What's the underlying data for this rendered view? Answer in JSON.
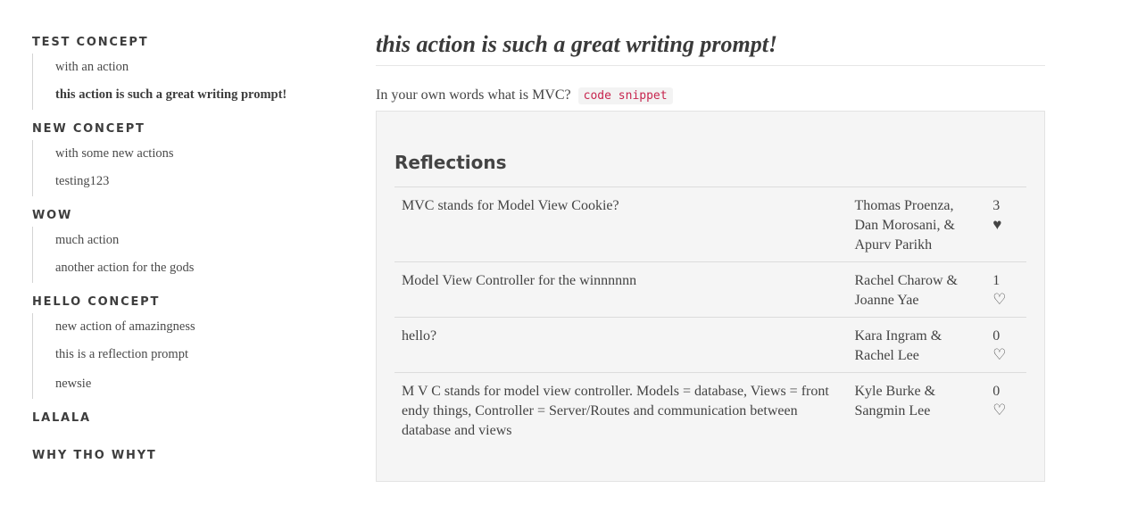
{
  "sidebar": {
    "sections": [
      {
        "title": "TEST CONCEPT",
        "items": [
          {
            "label": "with an action",
            "active": false
          },
          {
            "label": "this action is such a great writing prompt!",
            "active": true
          }
        ]
      },
      {
        "title": "NEW CONCEPT",
        "items": [
          {
            "label": "with some new actions",
            "active": false
          },
          {
            "label": "testing123",
            "active": false
          }
        ]
      },
      {
        "title": "WOW",
        "items": [
          {
            "label": "much action",
            "active": false
          },
          {
            "label": "another action for the gods",
            "active": false
          }
        ]
      },
      {
        "title": "HELLO CONCEPT",
        "items": [
          {
            "label": "new action of amazingness",
            "active": false
          },
          {
            "label": "this is a reflection prompt",
            "active": false
          },
          {
            "label": "newsie",
            "active": false
          }
        ]
      },
      {
        "title": "LALALA",
        "items": []
      },
      {
        "title": "WHY THO WHYT",
        "items": []
      }
    ]
  },
  "main": {
    "prompt_title": "this action is such a great writing prompt!",
    "question": "In your own words what is MVC?",
    "code_snippet": "code snippet",
    "reflections_heading": "Reflections",
    "reflections": [
      {
        "answer": "MVC stands for Model View Cookie?",
        "authors": "Thomas Proenza, Dan Morosani, & Apurv Parikh",
        "likes": "3",
        "liked": true
      },
      {
        "answer": "Model View Controller for the winnnnnn",
        "authors": "Rachel Charow & Joanne Yae",
        "likes": "1",
        "liked": false
      },
      {
        "answer": "hello?",
        "authors": "Kara Ingram & Rachel Lee",
        "likes": "0",
        "liked": false
      },
      {
        "answer": "M V C stands for model view controller. Models = database, Views = front endy things, Controller = Server/Routes and communication between database and views",
        "authors": "Kyle Burke & Sangmin Lee",
        "likes": "0",
        "liked": false
      }
    ]
  },
  "icons": {
    "heart_filled": "heart-filled-icon",
    "heart_outline": "heart-outline-icon"
  },
  "colors": {
    "code_text": "#c7254e",
    "panel_bg": "#f5f5f5"
  }
}
